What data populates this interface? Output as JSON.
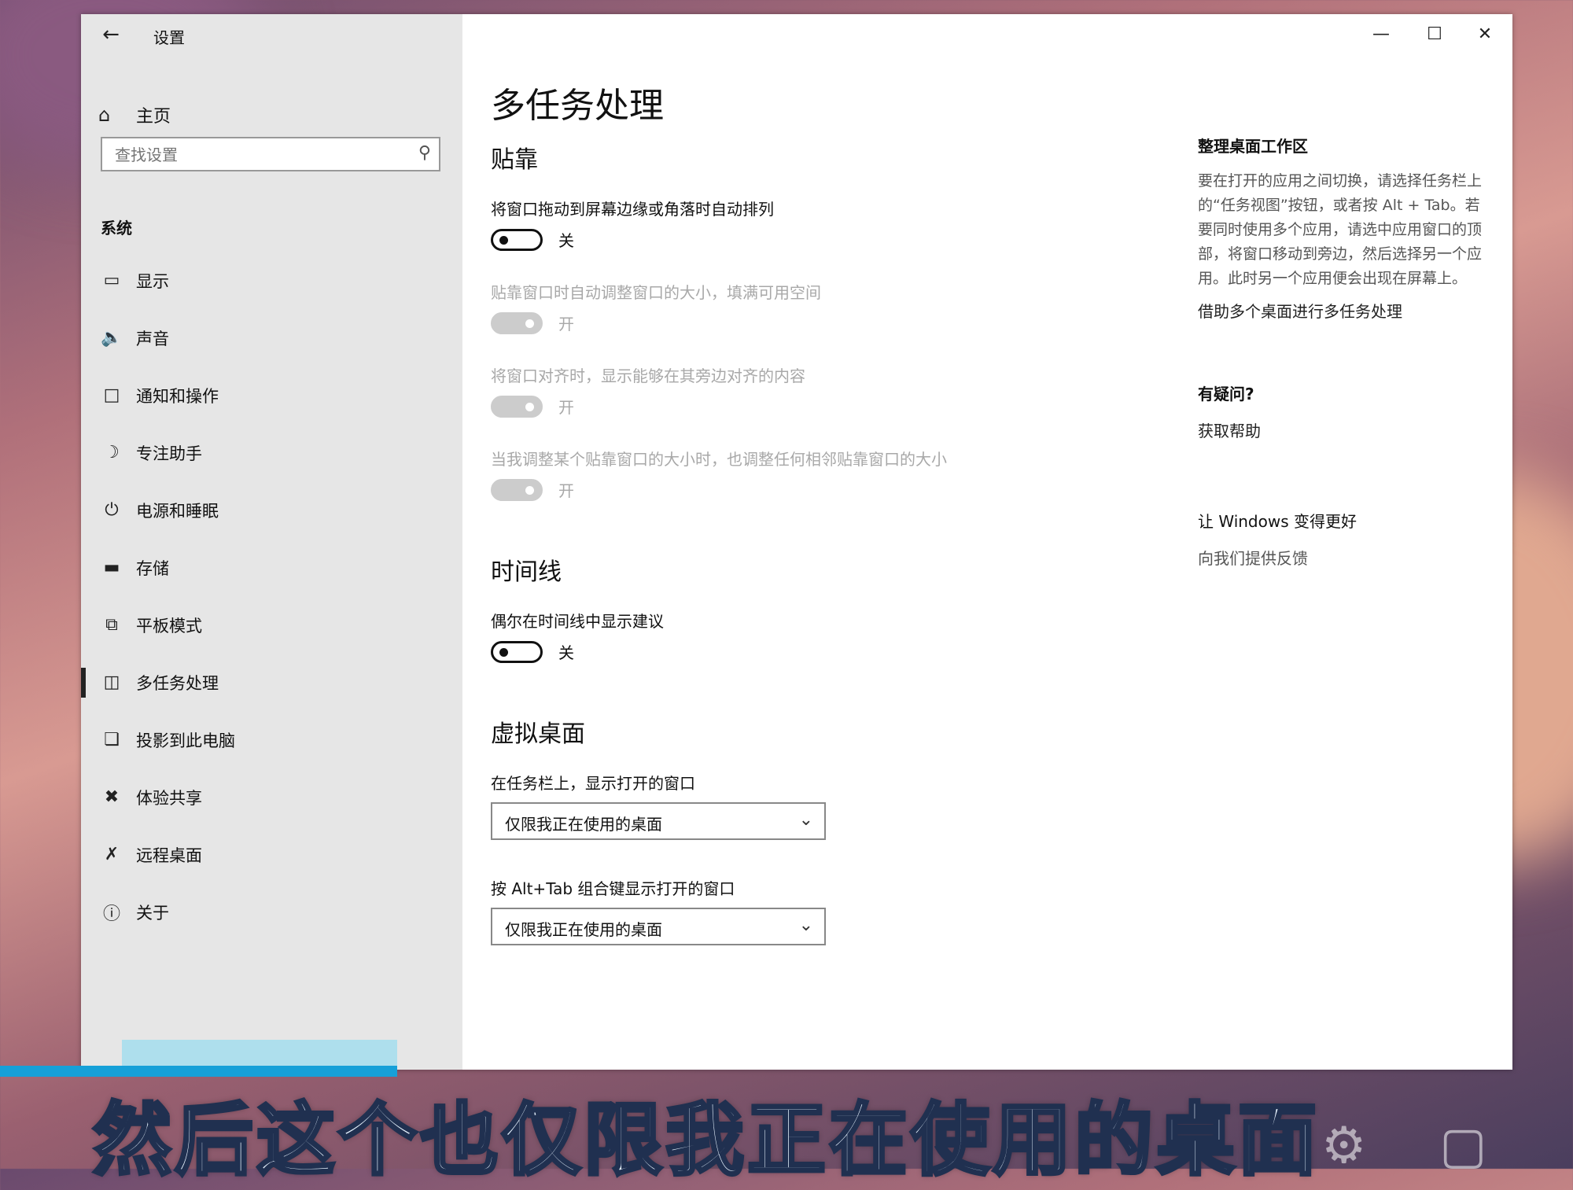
{
  "window": {
    "title": "设置",
    "back_icon": "arrow-left-icon"
  },
  "sidebar": {
    "home_label": "主页",
    "search_placeholder": "查找设置",
    "section": "系统",
    "items": [
      {
        "label": "显示",
        "icon": "monitor-icon"
      },
      {
        "label": "声音",
        "icon": "speaker-icon"
      },
      {
        "label": "通知和操作",
        "icon": "notification-icon"
      },
      {
        "label": "专注助手",
        "icon": "moon-icon"
      },
      {
        "label": "电源和睡眠",
        "icon": "power-icon"
      },
      {
        "label": "存储",
        "icon": "storage-icon"
      },
      {
        "label": "平板模式",
        "icon": "tablet-icon"
      },
      {
        "label": "多任务处理",
        "icon": "multitask-icon",
        "active": true
      },
      {
        "label": "投影到此电脑",
        "icon": "project-icon"
      },
      {
        "label": "体验共享",
        "icon": "share-icon"
      },
      {
        "label": "远程桌面",
        "icon": "remote-icon"
      },
      {
        "label": "关于",
        "icon": "info-icon"
      }
    ]
  },
  "main": {
    "title": "多任务处理",
    "snap": {
      "heading": "贴靠",
      "opt1": "将窗口拖动到屏幕边缘或角落时自动排列",
      "opt1_state": "关",
      "opt2": "贴靠窗口时自动调整窗口的大小，填满可用空间",
      "opt2_state": "开",
      "opt3": "将窗口对齐时，显示能够在其旁边对齐的内容",
      "opt3_state": "开",
      "opt4": "当我调整某个贴靠窗口的大小时，也调整任何相邻贴靠窗口的大小",
      "opt4_state": "开"
    },
    "timeline": {
      "heading": "时间线",
      "opt": "偶尔在时间线中显示建议",
      "state": "关"
    },
    "desktops": {
      "heading": "虚拟桌面",
      "taskbar_label": "在任务栏上，显示打开的窗口",
      "taskbar_value": "仅限我正在使用的桌面",
      "alttab_label": "按 Alt+Tab 组合键显示打开的窗口",
      "alttab_value": "仅限我正在使用的桌面"
    }
  },
  "aside": {
    "h1": "整理桌面工作区",
    "p1": "要在打开的应用之间切换，请选择任务栏上的“任务视图”按钮，或者按 Alt + Tab。若要同时使用多个应用，请选中应用窗口的顶部，将窗口移动到旁边，然后选择另一个应用。此时另一个应用便会出现在屏幕上。",
    "link1": "借助多个桌面进行多任务处理",
    "h2": "有疑问?",
    "link2": "获取帮助",
    "h3": "让 Windows 变得更好",
    "link3": "向我们提供反馈"
  },
  "caption": "然后这个也仅限我正在使用的桌面"
}
